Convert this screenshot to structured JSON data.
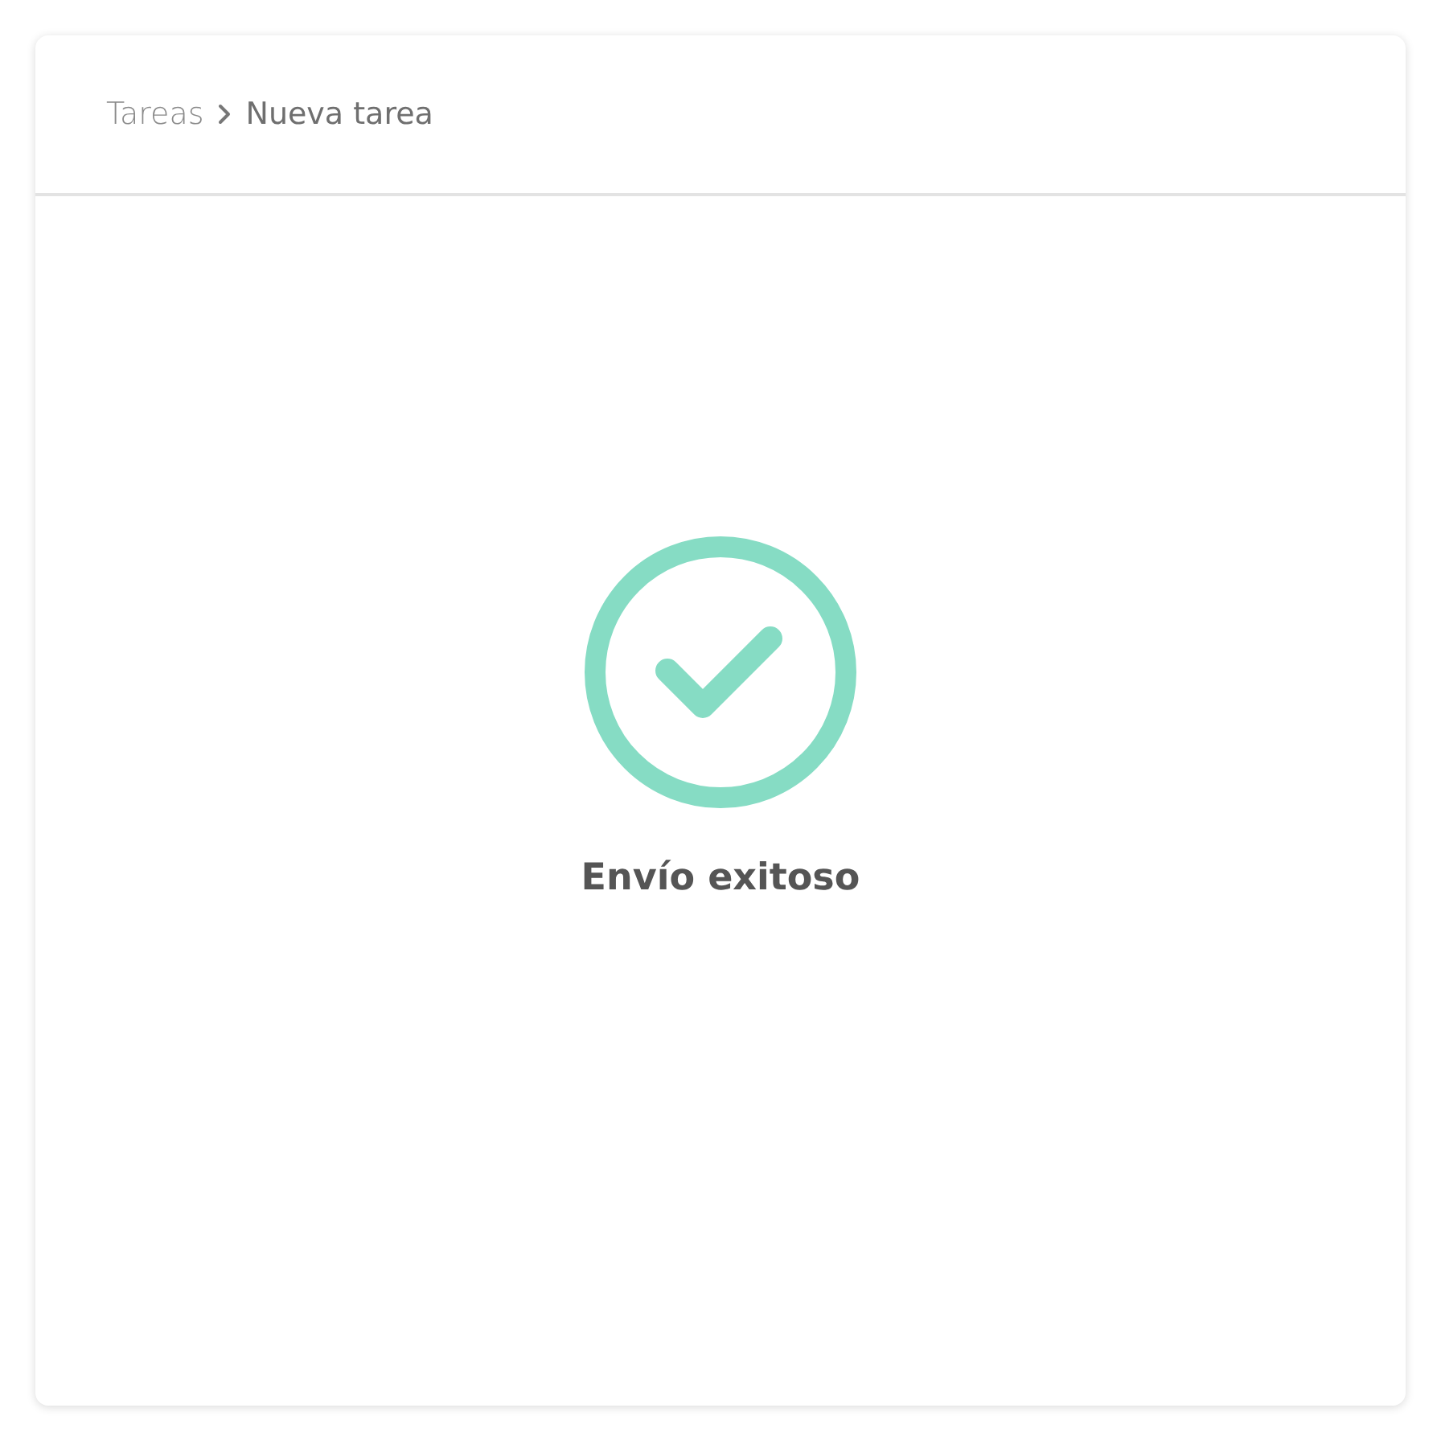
{
  "breadcrumb": [
    {
      "label": "Tareas",
      "current": false
    },
    {
      "label": "Nueva tarea",
      "current": true
    }
  ],
  "status": {
    "message": "Envío exitoso"
  }
}
